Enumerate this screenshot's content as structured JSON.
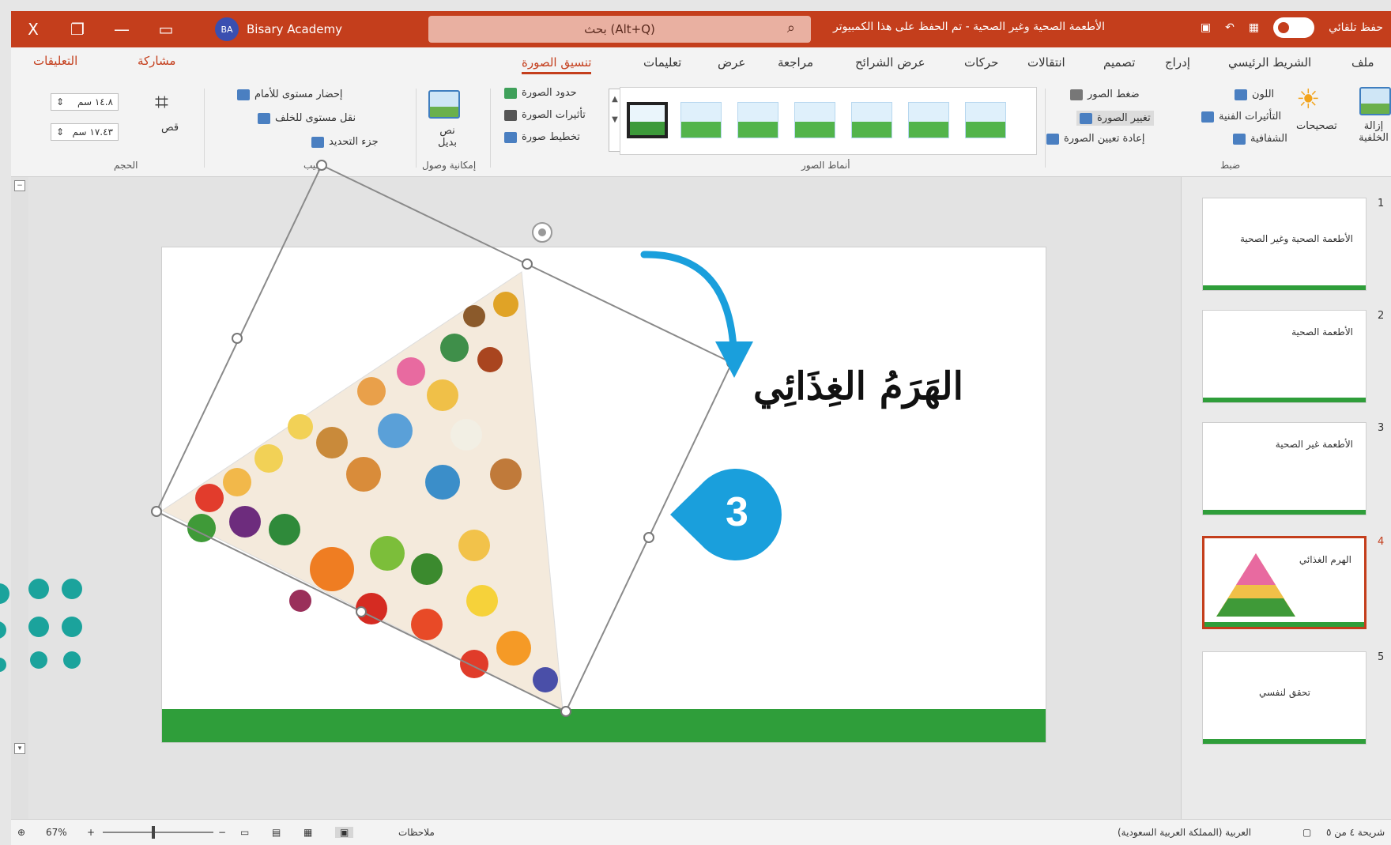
{
  "titlebar": {
    "close": "X",
    "user_initials": "BA",
    "user_name": "Bisary Academy",
    "search_text": "بحث (Alt+Q)",
    "document_title": "الأطعمة الصحية وغير الصحية - تم الحفظ على هذا الكمبيوتر",
    "autosave_label": "حفظ تلقائي"
  },
  "tabs": {
    "file": "ملف",
    "home": "الشريط الرئيسي",
    "insert": "إدراج",
    "design": "تصميم",
    "transitions": "انتقالات",
    "animations": "حركات",
    "slideshow": "عرض الشرائح",
    "review": "مراجعة",
    "view": "عرض",
    "help": "تعليمات",
    "picture_format": "تنسيق الصورة",
    "share": "مشاركة",
    "comments": "التعليقات"
  },
  "ribbon": {
    "remove_bg": "إزالة الخلفية",
    "corrections": "تصحيحات",
    "color": "اللون",
    "artistic": "التأثيرات الفنية",
    "transparency": "الشفافية",
    "compress": "ضغط الصور",
    "change_picture": "تغيير الصورة",
    "reset_picture": "إعادة تعيين الصورة",
    "group_adjust": "ضبط",
    "group_styles": "أنماط الصور",
    "border": "حدود الصورة",
    "effects": "تأثيرات الصورة",
    "layout": "تخطيط صورة",
    "alt_text": "نص بديل",
    "group_access": "إمكانية وصول",
    "bring_forward": "إحضار مستوى للأمام",
    "send_backward": "نقل مستوى للخلف",
    "selection_pane": "جزء التحديد",
    "group_arrange": "ترتيب",
    "crop": "قص",
    "height": "١٤.٨ سم",
    "width": "١٧.٤٣ سم",
    "group_size": "الحجم"
  },
  "slide": {
    "title": "الهَرَمُ الغِذَائِي",
    "callout_number": "3"
  },
  "thumbnails": [
    {
      "num": "1",
      "text": "الأطعمة الصحية وغير الصحية"
    },
    {
      "num": "2",
      "text": "الأطعمة الصحية"
    },
    {
      "num": "3",
      "text": "الأطعمة غير الصحية"
    },
    {
      "num": "4",
      "text": "الهرم الغذائي"
    },
    {
      "num": "5",
      "text": "تحقق لنفسي"
    }
  ],
  "status": {
    "slide_of": "شريحة ٤ من ٥",
    "language": "العربية (المملكة العربية السعودية)",
    "notes": "ملاحظات",
    "zoom": "67%"
  },
  "colors": {
    "accent": "#c43e1c",
    "slide_band": "#2f9e3a",
    "callout": "#1a9fdc",
    "logo": "#1ba39c"
  }
}
